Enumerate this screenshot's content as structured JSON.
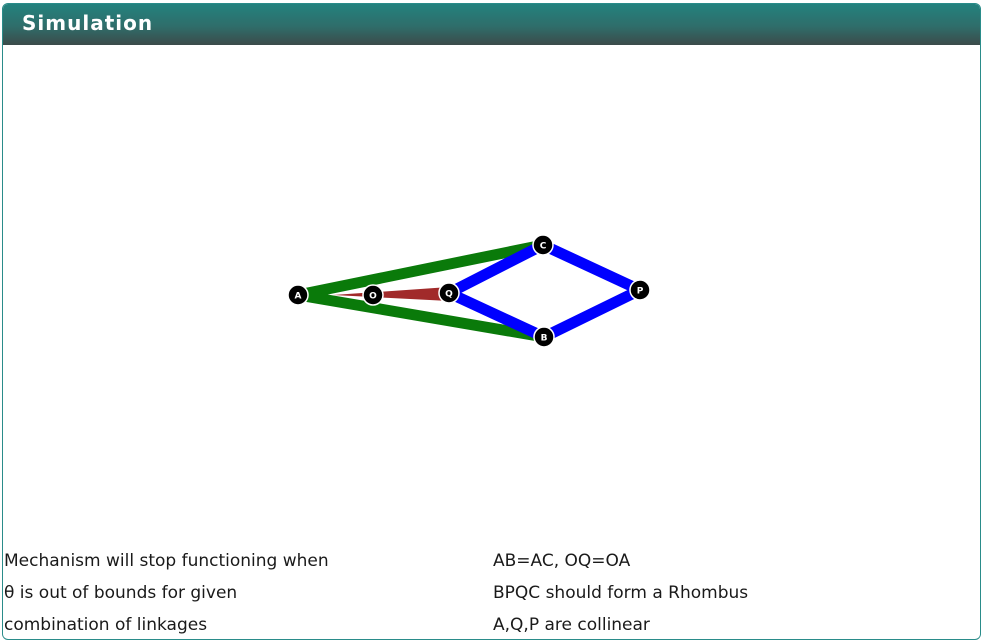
{
  "panel": {
    "title": "Simulation"
  },
  "mechanism": {
    "joints": {
      "A": "A",
      "O": "O",
      "Q": "Q",
      "C": "C",
      "B": "B",
      "P": "P"
    },
    "colors": {
      "fixed_links": "#0a7a0a",
      "crank": "#a12a2a",
      "rhombus": "#0000ff",
      "joint": "#000000",
      "joint_ring": "#ffffff"
    }
  },
  "notes": {
    "left": [
      "Mechanism will stop functioning when",
      "θ is out of bounds for given",
      "combination of linkages"
    ],
    "right": [
      "AB=AC, OQ=OA",
      "BPQC should form a Rhombus",
      "A,Q,P are collinear"
    ]
  }
}
